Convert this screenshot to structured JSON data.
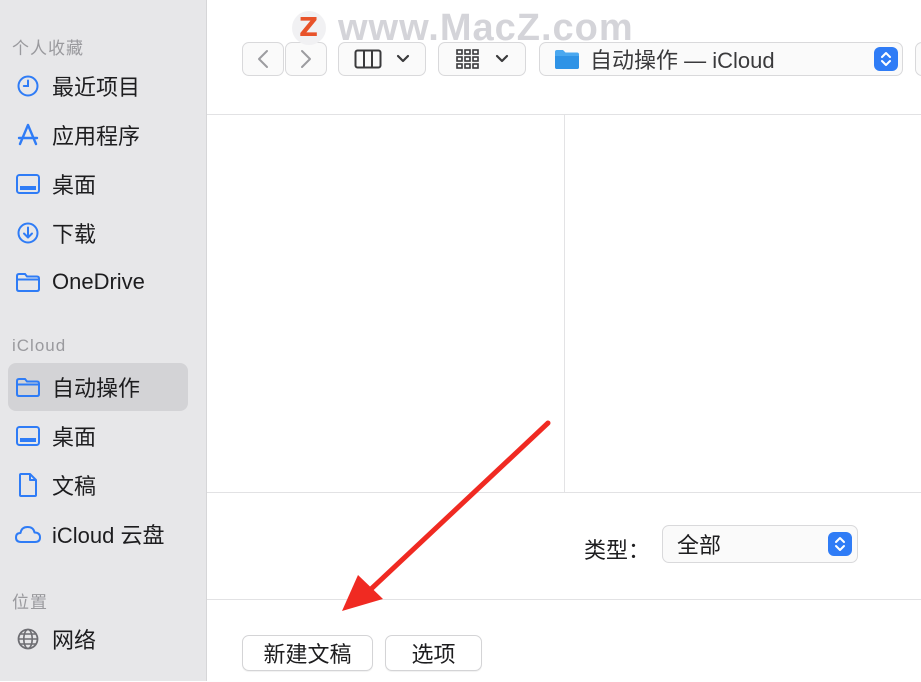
{
  "sidebar": {
    "favorites_header": "个人收藏",
    "favorites": [
      {
        "label": "最近项目",
        "icon": "clock-icon"
      },
      {
        "label": "应用程序",
        "icon": "app-store-icon"
      },
      {
        "label": "桌面",
        "icon": "desktop-icon"
      },
      {
        "label": "下载",
        "icon": "download-icon"
      },
      {
        "label": "OneDrive",
        "icon": "folder-icon"
      }
    ],
    "icloud_header": "iCloud",
    "icloud": [
      {
        "label": "自动操作",
        "icon": "folder-icon",
        "selected": true
      },
      {
        "label": "桌面",
        "icon": "desktop-icon"
      },
      {
        "label": "文稿",
        "icon": "document-icon"
      },
      {
        "label": "iCloud 云盘",
        "icon": "cloud-icon"
      }
    ],
    "locations_header": "位置",
    "locations": [
      {
        "label": "网络",
        "icon": "globe-icon"
      }
    ]
  },
  "toolbar": {
    "path_label": "自动操作 — iCloud",
    "watermark_text": "www.MacZ.com",
    "watermark_logo": "Z"
  },
  "filter": {
    "type_label": "类型：",
    "type_value": "全部"
  },
  "buttons": {
    "new_document": "新建文稿",
    "options": "选项"
  },
  "colors": {
    "accent": "#2f7cf6",
    "sidebar_icon": "#2f7cf6",
    "arrow": "#f02a22"
  }
}
